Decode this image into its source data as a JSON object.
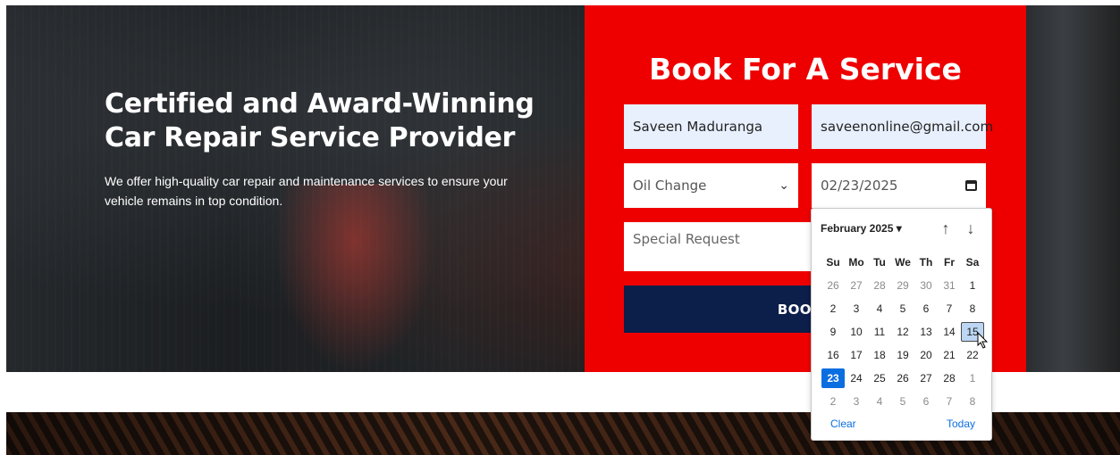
{
  "hero": {
    "title_line1": "Certified and Award-Winning",
    "title_line2": "Car Repair Service Provider",
    "description": "We offer high-quality car repair and maintenance services to ensure your vehicle remains in top condition."
  },
  "booking": {
    "title": "Book For A Service",
    "name_value": "Saveen Maduranga",
    "email_value": "saveenonline@gmail.com",
    "service_value": "Oil Change",
    "date_value": "02/23/2025",
    "request_placeholder": "Special Request",
    "button_label_visible": "BOOK I"
  },
  "datepicker": {
    "month_label": "February 2025 ▾",
    "up_icon": "↑",
    "down_icon": "↓",
    "weekday_headers": [
      "Su",
      "Mo",
      "Tu",
      "We",
      "Th",
      "Fr",
      "Sa"
    ],
    "weeks": [
      [
        "26",
        "27",
        "28",
        "29",
        "30",
        "31",
        "1"
      ],
      [
        "2",
        "3",
        "4",
        "5",
        "6",
        "7",
        "8"
      ],
      [
        "9",
        "10",
        "11",
        "12",
        "13",
        "14",
        "15"
      ],
      [
        "16",
        "17",
        "18",
        "19",
        "20",
        "21",
        "22"
      ],
      [
        "23",
        "24",
        "25",
        "26",
        "27",
        "28",
        "1"
      ],
      [
        "2",
        "3",
        "4",
        "5",
        "6",
        "7",
        "8"
      ]
    ],
    "selected_day": "23",
    "hovered_day": "15",
    "clear_label": "Clear",
    "today_label": "Today"
  },
  "colors": {
    "booking_bg": "#ee0000",
    "button_bg": "#0c1e4a",
    "selected_day_bg": "#0b6ee0",
    "link": "#0b6ee0"
  }
}
